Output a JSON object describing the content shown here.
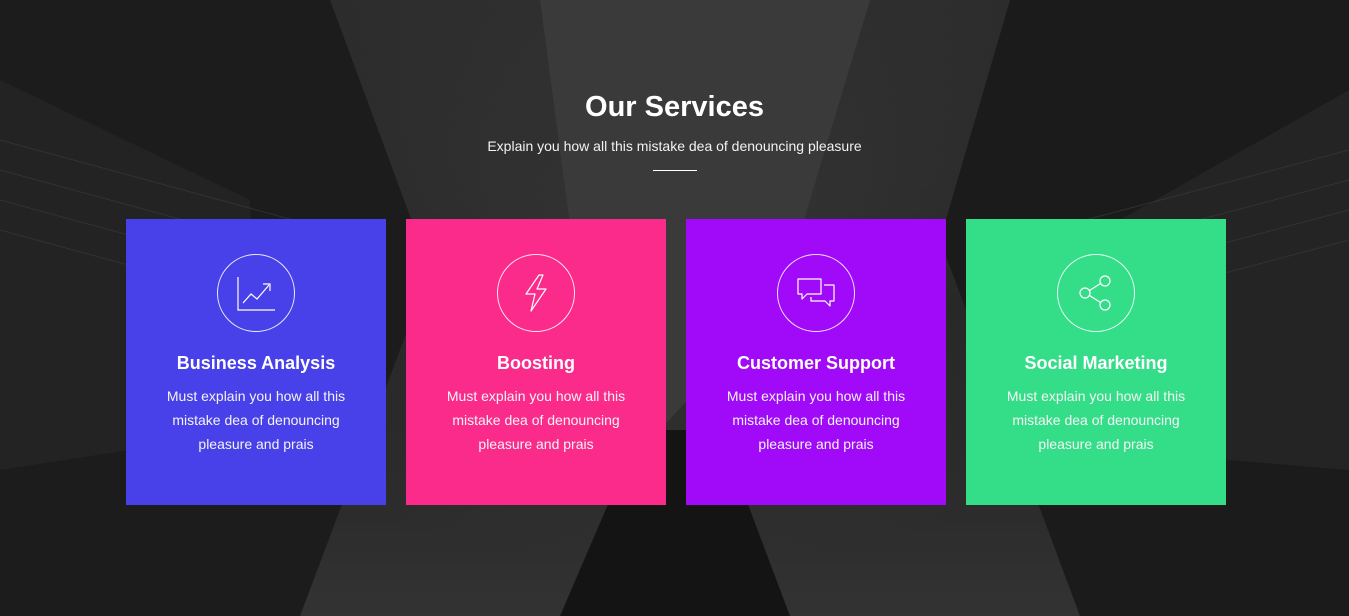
{
  "header": {
    "title": "Our Services",
    "subtitle": "Explain you how all this mistake dea of denouncing pleasure"
  },
  "services": [
    {
      "title": "Business Analysis",
      "text": "Must explain you how all this mistake dea of denouncing pleasure and prais",
      "icon": "line-chart-icon",
      "color": "#4840e8"
    },
    {
      "title": "Boosting",
      "text": "Must explain you how all this mistake dea of denouncing pleasure and prais",
      "icon": "lightning-icon",
      "color": "#fb2b8b"
    },
    {
      "title": "Customer Support",
      "text": "Must explain you how all this mistake dea of denouncing pleasure and prais",
      "icon": "chat-bubbles-icon",
      "color": "#a00af8"
    },
    {
      "title": "Social Marketing",
      "text": "Must explain you how all this mistake dea of denouncing pleasure and prais",
      "icon": "share-icon",
      "color": "#34de89"
    }
  ]
}
